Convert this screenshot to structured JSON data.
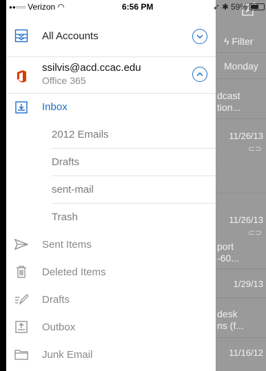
{
  "status_bar": {
    "carrier": "Verizon",
    "time": "6:56 PM",
    "battery": "59%"
  },
  "drawer": {
    "all_accounts_label": "All Accounts",
    "account": {
      "email": "ssilvis@acd.ccac.edu",
      "service": "Office 365"
    },
    "inbox_label": "Inbox",
    "inbox_subfolders": [
      "2012 Emails",
      "Drafts",
      "sent-mail",
      "Trash"
    ],
    "folders": [
      {
        "label": "Sent Items",
        "icon": "paper-plane-icon"
      },
      {
        "label": "Deleted Items",
        "icon": "trash-icon"
      },
      {
        "label": "Drafts",
        "icon": "pencil-icon"
      },
      {
        "label": "Outbox",
        "icon": "outbox-icon"
      },
      {
        "label": "Junk Email",
        "icon": "folder-icon"
      }
    ]
  },
  "background_list": {
    "filter_label": "Filter",
    "day_header": "Monday",
    "fragments": [
      "dcast",
      "tion...",
      "11/26/13",
      "11/26/13",
      "port",
      "-60...",
      "1/29/13",
      "desk",
      "ns (f...",
      "11/16/12"
    ]
  },
  "colors": {
    "accent": "#1c6fc4",
    "office_red": "#d83b01",
    "overlay": "#9a9a9a"
  }
}
